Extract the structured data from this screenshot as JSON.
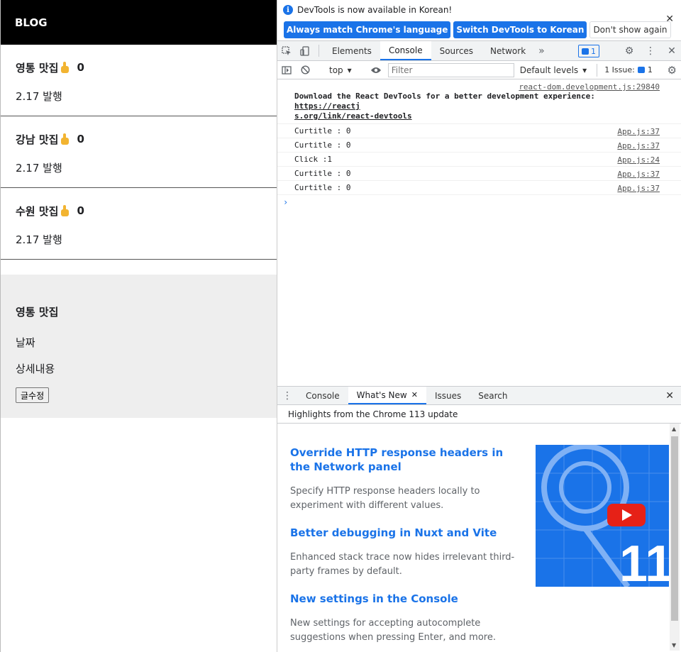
{
  "app": {
    "brand": "BLOG",
    "posts": [
      {
        "title": "영통 맛집",
        "likes": "0",
        "date": "2.17 발행"
      },
      {
        "title": "강남 맛집",
        "likes": "0",
        "date": "2.17 발행"
      },
      {
        "title": "수원 맛집",
        "likes": "0",
        "date": "2.17 발행"
      }
    ],
    "modal": {
      "title": "영통 맛집",
      "date": "날짜",
      "detail": "상세내용",
      "button": "글수정"
    }
  },
  "devtools": {
    "infobar": {
      "message": "DevTools is now available in Korean!",
      "btn_match": "Always match Chrome's language",
      "btn_switch": "Switch DevTools to Korean",
      "btn_dont": "Don't show again"
    },
    "tabs": [
      "Elements",
      "Console",
      "Sources",
      "Network"
    ],
    "active_tab": "Console",
    "message_count": "1",
    "console_toolbar": {
      "context": "top",
      "filter_placeholder": "Filter",
      "levels": "Default levels",
      "issues": "1 Issue:",
      "issue_count": "1"
    },
    "console_messages": {
      "react_src": "react-dom.development.js:29840",
      "react_text": "Download the React DevTools for a better development experience: ",
      "react_link1": "https://reactj",
      "react_link2": "s.org/link/react-devtools",
      "logs": [
        {
          "text": "Curtitle : 0",
          "src": "App.js:37"
        },
        {
          "text": "Curtitle : 0",
          "src": "App.js:37"
        },
        {
          "text": "Click :1",
          "src": "App.js:24"
        },
        {
          "text": "Curtitle : 0",
          "src": "App.js:37"
        },
        {
          "text": "Curtitle : 0",
          "src": "App.js:37"
        }
      ]
    },
    "drawer": {
      "tabs": [
        "Console",
        "What's New",
        "Issues",
        "Search"
      ],
      "active_tab": "What's New",
      "highlights": "Highlights from the Chrome 113 update",
      "items": [
        {
          "title": "Override HTTP response headers in the Network panel",
          "desc": "Specify HTTP response headers locally to experiment with different values."
        },
        {
          "title": "Better debugging in Nuxt and Vite",
          "desc": "Enhanced stack trace now hides irrelevant third-party frames by default."
        },
        {
          "title": "New settings in the Console",
          "desc": "New settings for accepting autocomplete suggestions when pressing Enter, and more."
        }
      ],
      "image_version": "11"
    }
  }
}
